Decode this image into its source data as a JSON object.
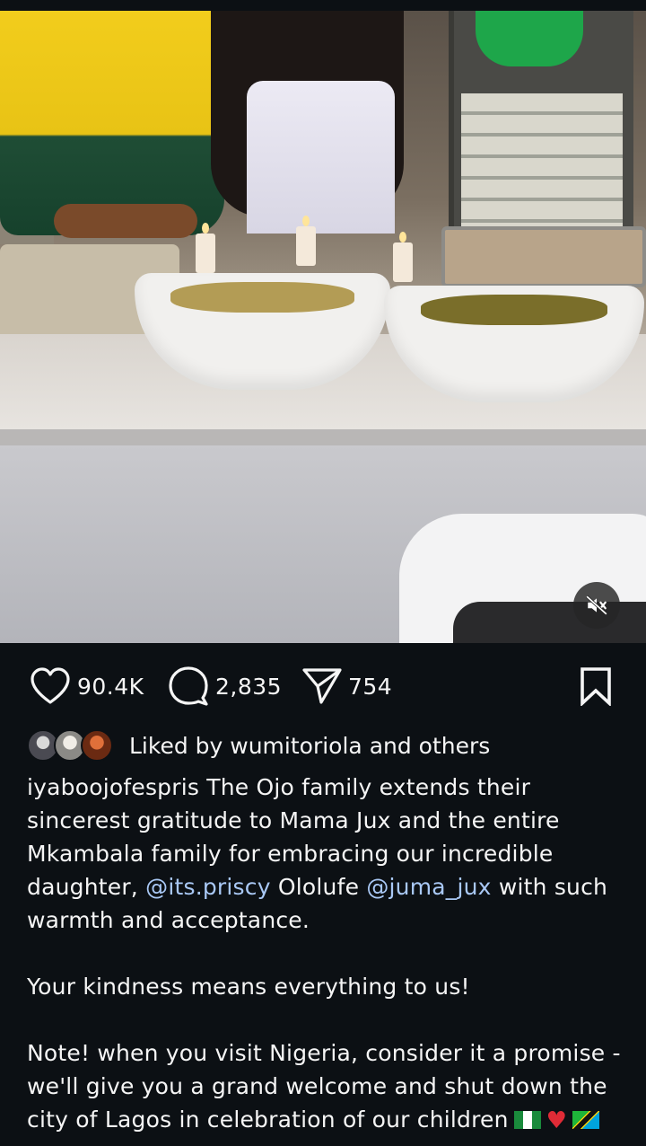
{
  "post": {
    "stats": {
      "likes": "90.4K",
      "comments": "2,835",
      "shares": "754"
    },
    "liked_by_text": "Liked by wumitoriola and others",
    "caption": {
      "username": "iyaboojofespris",
      "line1": "The Ojo family extends their sincerest gratitude to Mama Jux and the entire Mkambala family for embracing our incredible daughter,",
      "mention1": "@its.priscy",
      "middle": "Ololufe",
      "mention2": "@juma_jux",
      "line1_end": "with such warmth and acceptance.",
      "paragraph2": "Your kindness means everything to us!",
      "paragraph3": "Note!  when you visit Nigeria, consider it a promise - we'll give you a grand welcome and shut down the city of Lagos in celebration of our children"
    }
  },
  "icons": {
    "mute": "volume-muted-icon",
    "like": "heart-icon",
    "comment": "comment-bubble-icon",
    "share": "paper-plane-icon",
    "save": "bookmark-icon",
    "emoji": [
      "nigeria-flag",
      "red-heart",
      "tanzania-flag"
    ]
  },
  "colors": {
    "background": "#0c1014",
    "text": "#f5f5f5",
    "mention": "#a9c8f5"
  }
}
